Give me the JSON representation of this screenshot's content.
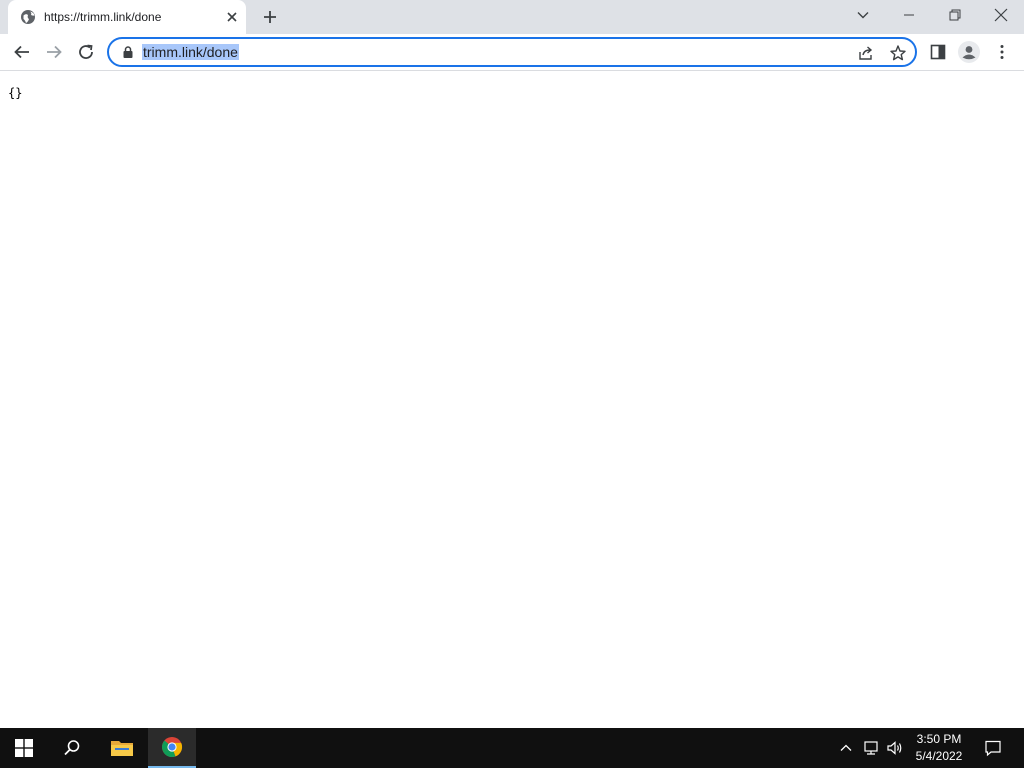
{
  "browser": {
    "tab": {
      "title": "https://trimm.link/done"
    },
    "omnibox": {
      "url": "trimm.link/done"
    }
  },
  "page": {
    "body_text": "{}"
  },
  "taskbar": {
    "clock": {
      "time": "3:50 PM",
      "date": "5/4/2022"
    }
  },
  "colors": {
    "tab_strip": "#dee1e6",
    "omnibox_focus": "#1a73e8",
    "selection": "#a8c7fa",
    "taskbar": "#101010"
  },
  "icons": [
    "globe-icon",
    "close-icon",
    "plus-icon",
    "chevron-down-icon",
    "minimize-icon",
    "restore-icon",
    "back-icon",
    "forward-icon",
    "reload-icon",
    "lock-icon",
    "share-icon",
    "star-icon",
    "side-panel-icon",
    "profile-icon",
    "menu-icon",
    "windows-start-icon",
    "search-icon",
    "file-explorer-icon",
    "chrome-icon",
    "chevron-up-icon",
    "network-icon",
    "volume-icon",
    "notification-icon"
  ]
}
